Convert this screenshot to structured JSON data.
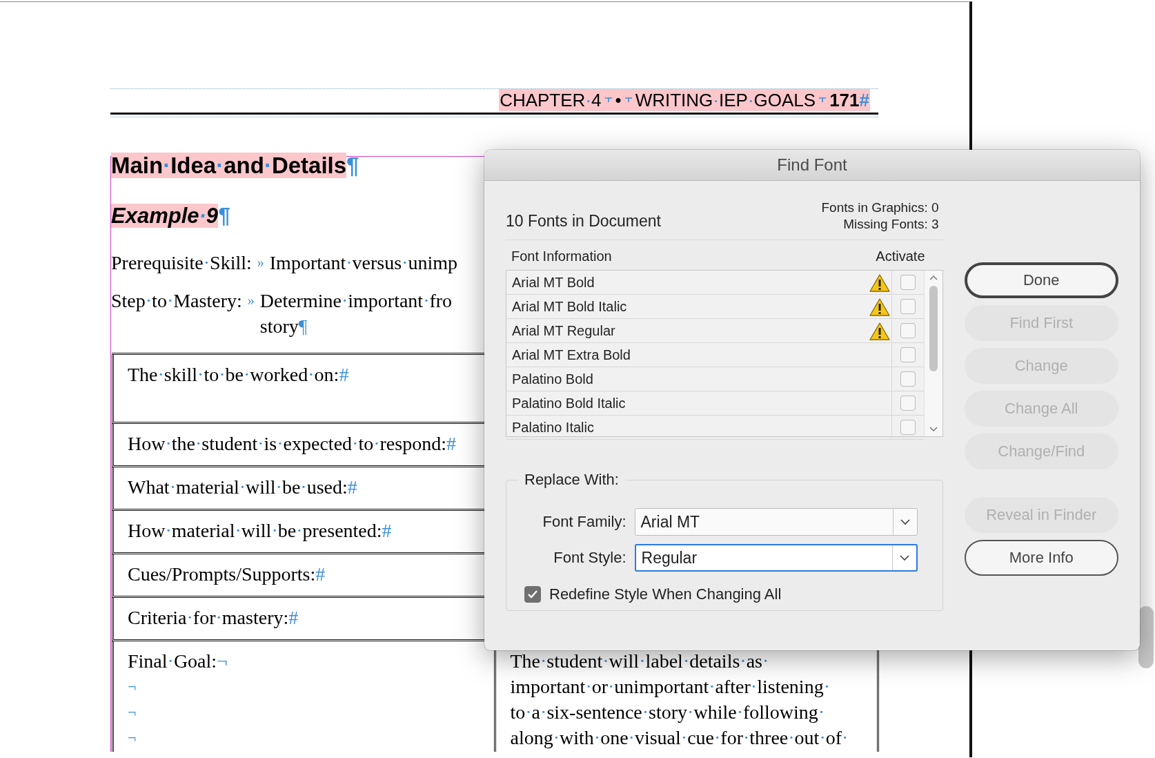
{
  "document": {
    "running_header": {
      "chapter": "CHAPTER·4",
      "separator": "•",
      "section": "WRITING·IEP·GOALS",
      "page": "171",
      "mark": "#"
    },
    "heading": {
      "text": "Main·Idea·and·Details",
      "mark": "¶"
    },
    "subheading": {
      "text": "Example·9",
      "mark": "¶"
    },
    "fields": [
      {
        "label": "Prerequisite·Skill:",
        "tab": "»",
        "value": "Important·versus·unimp"
      },
      {
        "label": "Step·to·Mastery:",
        "tab": "»",
        "value": "Determine·important·fro",
        "continuation": "story",
        "mark": "¶"
      }
    ],
    "table_rows": [
      {
        "text": "The·skill·to·be·worked·on:",
        "mark": "#",
        "tall": true
      },
      {
        "text": "How·the·student·is·expected·to·respond:",
        "mark": "#",
        "tall": false
      },
      {
        "text": "What·material·will·be·used:",
        "mark": "#",
        "tall": false
      },
      {
        "text": "How·material·will·be·presented:",
        "mark": "#",
        "tall": false
      },
      {
        "text": "Cues/Prompts/Supports:",
        "mark": "#",
        "tall": false
      },
      {
        "text": "Criteria·for·mastery:",
        "mark": "#",
        "tall": false
      }
    ],
    "final_row": {
      "label": "Final·Goal:",
      "mark": "¬",
      "breaks": [
        "¬",
        "¬",
        "¬"
      ],
      "goal_lines": [
        "The·student·will·label·details·as·",
        "important·or·unimportant·after·listening·",
        "to·a·six-sentence·story·while·following·",
        "along·with·one·visual·cue·for·three·out·of·"
      ]
    }
  },
  "dialog": {
    "title": "Find Font",
    "summary": "10 Fonts in Document",
    "stats": [
      "Fonts in Graphics: 0",
      "Missing Fonts: 3"
    ],
    "columns": [
      "Font Information",
      "Activate"
    ],
    "fonts": [
      {
        "name": "Arial MT Bold",
        "missing": true,
        "checked": false
      },
      {
        "name": "Arial MT Bold Italic",
        "missing": true,
        "checked": false
      },
      {
        "name": "Arial MT Regular",
        "missing": true,
        "checked": false
      },
      {
        "name": "Arial MT Extra Bold",
        "missing": false,
        "checked": false
      },
      {
        "name": "Palatino Bold",
        "missing": false,
        "checked": false
      },
      {
        "name": "Palatino Bold Italic",
        "missing": false,
        "checked": false
      },
      {
        "name": "Palatino Italic",
        "missing": false,
        "checked": false
      }
    ],
    "replace": {
      "legend": "Replace With:",
      "family": {
        "label": "Font Family:",
        "value": "Arial MT",
        "focused": false
      },
      "style": {
        "label": "Font Style:",
        "value": "Regular",
        "focused": true
      },
      "redefine": {
        "label": "Redefine Style When Changing All",
        "checked": true
      }
    },
    "buttons": [
      {
        "label": "Done",
        "disabled": false,
        "default": true,
        "gap": false
      },
      {
        "label": "Find First",
        "disabled": true,
        "default": false,
        "gap": false
      },
      {
        "label": "Change",
        "disabled": true,
        "default": false,
        "gap": false
      },
      {
        "label": "Change All",
        "disabled": true,
        "default": false,
        "gap": false
      },
      {
        "label": "Change/Find",
        "disabled": true,
        "default": false,
        "gap": false
      },
      {
        "label": "Reveal in Finder",
        "disabled": true,
        "default": false,
        "gap": true
      },
      {
        "label": "More Info",
        "disabled": false,
        "default": false,
        "gap": false
      }
    ]
  }
}
